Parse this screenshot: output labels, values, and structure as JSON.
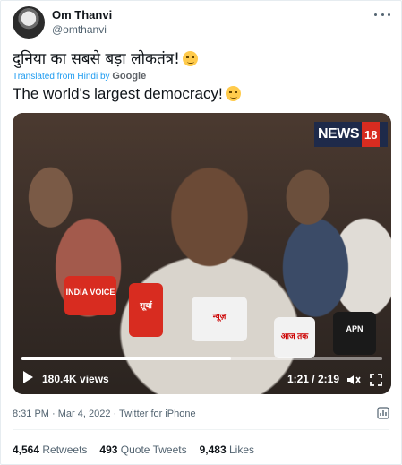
{
  "author": {
    "name": "Om Thanvi",
    "handle": "@omthanvi",
    "avatar_icon": "profile-photo"
  },
  "tweet": {
    "original_text": "दुनिया का सबसे बड़ा लोकतंत्र!",
    "translated_from_prefix": "Translated from Hindi by",
    "translator": "Google",
    "translated_text": "The world's largest democracy!",
    "emoji": "smirking-face-emoji"
  },
  "video": {
    "channel_logo_text": "NEWS",
    "channel_logo_number": "18",
    "mic_labels": [
      "INDIA VOICE",
      "सूर्या",
      "न्यूज़",
      "आज तक",
      "APN"
    ],
    "views": "180.4K views",
    "time": "1:21 / 2:19",
    "progress_fraction": 0.58
  },
  "meta": {
    "timestamp": "8:31 PM · Mar 4, 2022 · Twitter for iPhone"
  },
  "stats": {
    "retweets_count": "4,564",
    "retweets_label": "Retweets",
    "quotes_count": "493",
    "quotes_label": "Quote Tweets",
    "likes_count": "9,483",
    "likes_label": "Likes"
  },
  "colors": {
    "link": "#1d9bf0",
    "secondary_text": "#536471",
    "primary_text": "#0f1419"
  }
}
